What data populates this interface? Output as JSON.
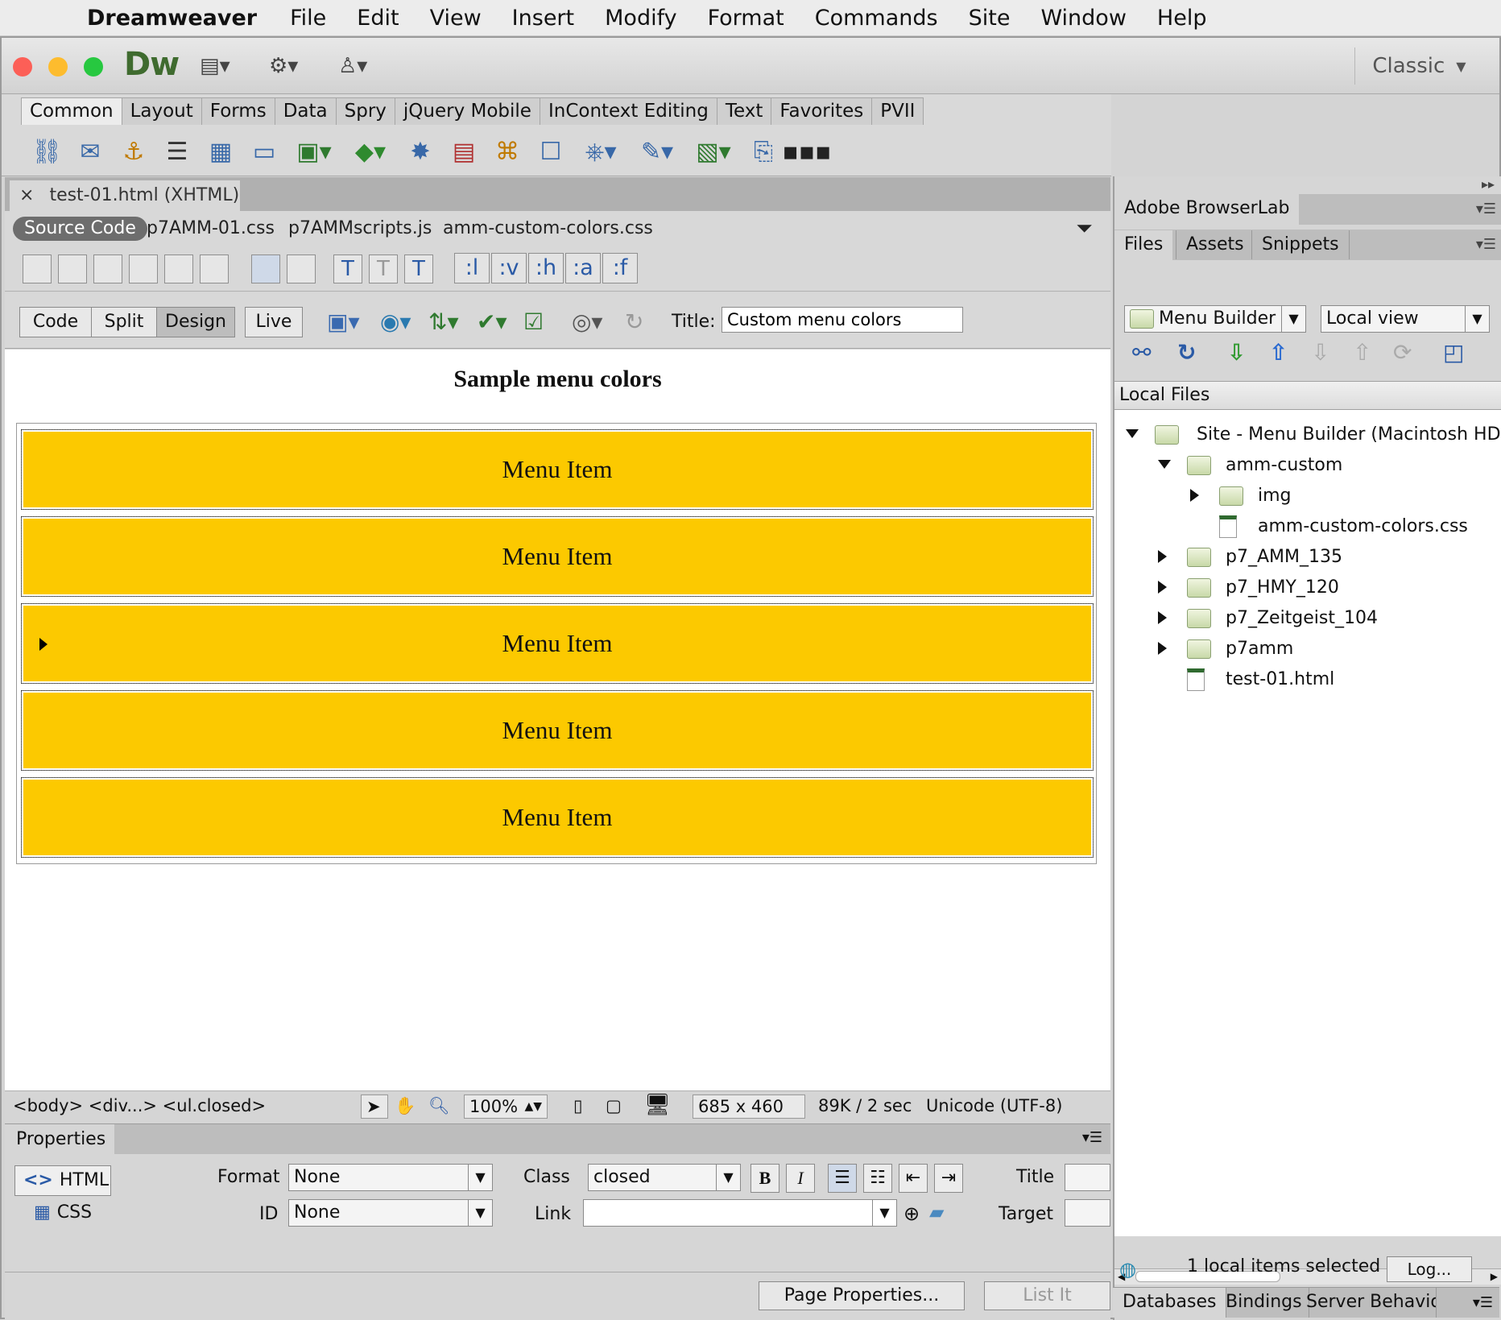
{
  "menubar": {
    "app_name": "Dreamweaver",
    "items": [
      "File",
      "Edit",
      "View",
      "Insert",
      "Modify",
      "Format",
      "Commands",
      "Site",
      "Window",
      "Help"
    ]
  },
  "titlebar": {
    "logo": "Dw",
    "workspace": "Classic"
  },
  "insert_panel": {
    "tabs": [
      "Common",
      "Layout",
      "Forms",
      "Data",
      "Spry",
      "jQuery Mobile",
      "InContext Editing",
      "Text",
      "Favorites",
      "PVII"
    ],
    "active_tab": "Common"
  },
  "document": {
    "tab_label": "test-01.html (XHTML)",
    "related_files": [
      "Source Code",
      "p7AMM-01.css",
      "p7AMMscripts.js",
      "amm-custom-colors.css"
    ],
    "pseudo_buttons": [
      ":l",
      ":v",
      ":h",
      ":a",
      ":f"
    ],
    "view_buttons": [
      "Code",
      "Split",
      "Design",
      "Live"
    ],
    "active_view": "Design",
    "title_label": "Title:",
    "title_value": "Custom menu colors"
  },
  "design": {
    "heading": "Sample menu colors",
    "menu_items": [
      "Menu Item",
      "Menu Item",
      "Menu Item",
      "Menu Item",
      "Menu Item"
    ],
    "menu_color": "#fcc900"
  },
  "statusbar": {
    "tag_selector": "<body> <div...> <ul.closed>",
    "zoom": "100%",
    "dimensions": "685 x 460",
    "size_time": "89K / 2 sec",
    "encoding": "Unicode (UTF-8)"
  },
  "properties": {
    "tab_label": "Properties",
    "html_label": "HTML",
    "css_label": "CSS",
    "format_label": "Format",
    "format_value": "None",
    "id_label": "ID",
    "id_value": "None",
    "class_label": "Class",
    "class_value": "closed",
    "link_label": "Link",
    "link_value": "",
    "title_label": "Title",
    "target_label": "Target",
    "page_properties": "Page Properties...",
    "list_item": "List It"
  },
  "right_panel": {
    "browserlab": "Adobe BrowserLab",
    "tabs": [
      "Files",
      "Assets",
      "Snippets"
    ],
    "site_select": "Menu Builder",
    "view_select": "Local view",
    "local_files_header": "Local Files",
    "tree": [
      {
        "label": "Site - Menu Builder (Macintosh HD:Us",
        "type": "folder",
        "depth": 0,
        "state": "open"
      },
      {
        "label": "amm-custom",
        "type": "folder",
        "depth": 1,
        "state": "open"
      },
      {
        "label": "img",
        "type": "folder",
        "depth": 2,
        "state": "closed"
      },
      {
        "label": "amm-custom-colors.css",
        "type": "file",
        "depth": 2,
        "state": "none"
      },
      {
        "label": "p7_AMM_135",
        "type": "folder",
        "depth": 1,
        "state": "closed"
      },
      {
        "label": "p7_HMY_120",
        "type": "folder",
        "depth": 1,
        "state": "closed"
      },
      {
        "label": "p7_Zeitgeist_104",
        "type": "folder",
        "depth": 1,
        "state": "closed"
      },
      {
        "label": "p7amm",
        "type": "folder",
        "depth": 1,
        "state": "closed"
      },
      {
        "label": "test-01.html",
        "type": "file",
        "depth": 1,
        "state": "none"
      }
    ],
    "status_text": "1 local items selected",
    "log_button": "Log...",
    "bottom_tabs": [
      "Databases",
      "Bindings",
      "Server Behavio"
    ]
  }
}
